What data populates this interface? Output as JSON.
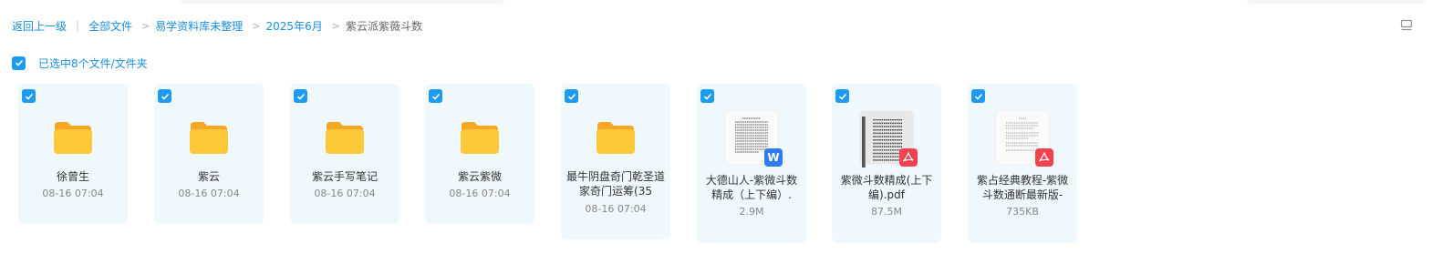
{
  "breadcrumb": {
    "back": "返回上一级",
    "items": [
      "全部文件",
      "易学资料库未整理",
      "2025年6月"
    ],
    "current": "紫云派紫薇斗数",
    "separator": ">",
    "divider": "|"
  },
  "selection": {
    "label": "已选中8个文件/文件夹",
    "checked": true
  },
  "colors": {
    "accent": "#1a8fe0",
    "checkbox": "#1d9bf0",
    "card_bg": "#eff8fd",
    "folder": "#fbbf24"
  },
  "files": [
    {
      "type": "folder",
      "name": "徐曾生",
      "meta": "08-16 07:04",
      "icon": "folder-icon",
      "selected": true
    },
    {
      "type": "folder",
      "name": "紫云",
      "meta": "08-16 07:04",
      "icon": "folder-icon",
      "selected": true
    },
    {
      "type": "folder",
      "name": "紫云手写笔记",
      "meta": "08-16 07:04",
      "icon": "folder-icon",
      "selected": true
    },
    {
      "type": "folder",
      "name": "紫云紫微",
      "meta": "08-16 07:04",
      "icon": "folder-icon",
      "selected": true
    },
    {
      "type": "folder",
      "name": "最牛阴盘奇门乾圣道家奇门运筹(35",
      "meta": "08-16 07:04",
      "icon": "folder-icon",
      "selected": true
    },
    {
      "type": "word",
      "name": "大德山人-紫微斗数精成（上下编）.",
      "meta": "2.9M",
      "icon": "word-doc-icon",
      "badge": "W",
      "selected": true
    },
    {
      "type": "pdf",
      "name": "紫微斗数精成(上下编).pdf",
      "meta": "87.5M",
      "icon": "pdf-icon",
      "selected": true
    },
    {
      "type": "pdf",
      "name": "紫占经典教程-紫微斗数通断最新版-",
      "meta": "735KB",
      "icon": "pdf-icon",
      "selected": true
    }
  ]
}
